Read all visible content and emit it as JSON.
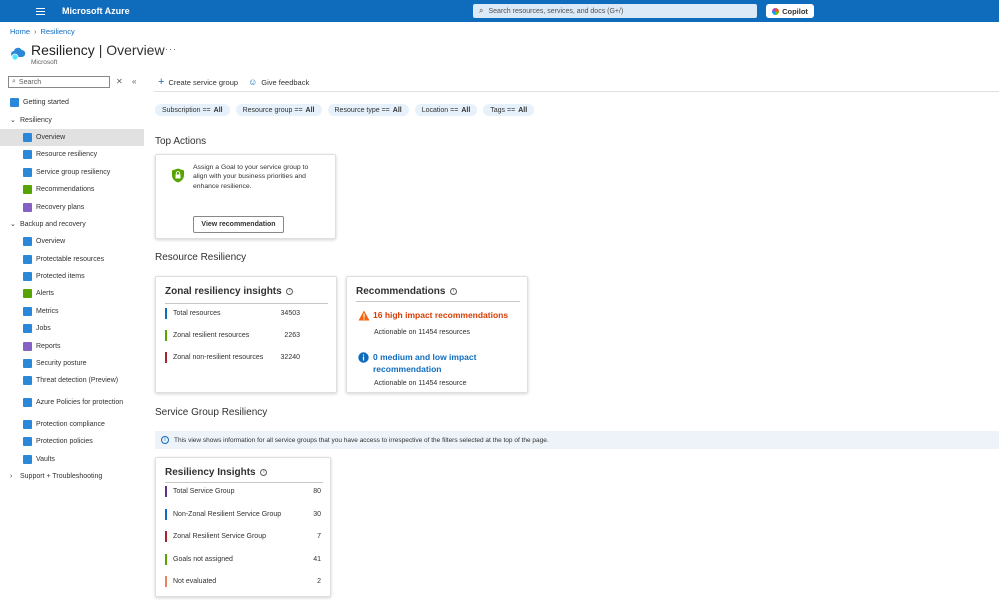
{
  "header": {
    "brand": "Microsoft Azure",
    "search_placeholder": "Search resources, services, and docs (G+/)",
    "copilot_label": "Copilot"
  },
  "breadcrumb": [
    "Home",
    "Resiliency"
  ],
  "page": {
    "title": "Resiliency",
    "title_suffix": "| Overview",
    "subtitle": "Microsoft",
    "more": "···"
  },
  "sidebar": {
    "search_placeholder": "Search",
    "items": [
      {
        "label": "Getting started",
        "level": 0,
        "icon": "rocket-icon",
        "color": "#2b88d8"
      },
      {
        "label": "Resiliency",
        "level": 0,
        "chevron": "⌄",
        "group": true
      },
      {
        "label": "Overview",
        "level": 1,
        "icon": "cloud-icon",
        "color": "#2b88d8",
        "active": true
      },
      {
        "label": "Resource resiliency",
        "level": 1,
        "icon": "resource-icon",
        "color": "#2b88d8"
      },
      {
        "label": "Service group resiliency",
        "level": 1,
        "icon": "service-group-icon",
        "color": "#2b88d8"
      },
      {
        "label": "Recommendations",
        "level": 1,
        "icon": "recommendations-icon",
        "color": "#57a300"
      },
      {
        "label": "Recovery plans",
        "level": 1,
        "icon": "recovery-plans-icon",
        "color": "#8661c5"
      },
      {
        "label": "Backup and recovery",
        "level": 0,
        "chevron": "⌄",
        "group": true
      },
      {
        "label": "Overview",
        "level": 1,
        "icon": "cloud-icon",
        "color": "#2b88d8"
      },
      {
        "label": "Protectable resources",
        "level": 1,
        "icon": "protectable-icon",
        "color": "#2b88d8"
      },
      {
        "label": "Protected items",
        "level": 1,
        "icon": "protected-items-icon",
        "color": "#2b88d8"
      },
      {
        "label": "Alerts",
        "level": 1,
        "icon": "alerts-icon",
        "color": "#57a300"
      },
      {
        "label": "Metrics",
        "level": 1,
        "icon": "metrics-icon",
        "color": "#2b88d8"
      },
      {
        "label": "Jobs",
        "level": 1,
        "icon": "jobs-icon",
        "color": "#2b88d8"
      },
      {
        "label": "Reports",
        "level": 1,
        "icon": "reports-icon",
        "color": "#8661c5"
      },
      {
        "label": "Security posture",
        "level": 1,
        "icon": "security-icon",
        "color": "#2b88d8"
      },
      {
        "label": "Threat detection (Preview)",
        "level": 1,
        "icon": "threat-icon",
        "color": "#2b88d8"
      },
      {
        "label": "Azure Policies for protection",
        "level": 1,
        "icon": "policy-icon",
        "color": "#2b88d8",
        "tall": true
      },
      {
        "label": "Protection compliance",
        "level": 1,
        "icon": "compliance-icon",
        "color": "#2b88d8"
      },
      {
        "label": "Protection policies",
        "level": 1,
        "icon": "protection-policies-icon",
        "color": "#2b88d8"
      },
      {
        "label": "Vaults",
        "level": 1,
        "icon": "vault-icon",
        "color": "#2b88d8"
      },
      {
        "label": "Support + Troubleshooting",
        "level": 0,
        "chevron": "›",
        "group": true
      }
    ]
  },
  "toolbar": {
    "create_label": "Create service group",
    "feedback_label": "Give feedback"
  },
  "filters": [
    {
      "name": "Subscription ==",
      "value": "All"
    },
    {
      "name": "Resource group ==",
      "value": "All"
    },
    {
      "name": "Resource type ==",
      "value": "All"
    },
    {
      "name": "Location ==",
      "value": "All"
    },
    {
      "name": "Tags ==",
      "value": "All"
    }
  ],
  "top_actions": {
    "title": "Top Actions",
    "text": "Assign a Goal to your service group to align with your business priorities and enhance resilience.",
    "button": "View recommendation"
  },
  "resource_resiliency": {
    "title": "Resource Resiliency",
    "zonal": {
      "title": "Zonal resiliency insights",
      "rows": [
        {
          "label": "Total resources",
          "value": "34503",
          "color": "#0f6cbd"
        },
        {
          "label": "Zonal resilient resources",
          "value": "2263",
          "color": "#57a300"
        },
        {
          "label": "Zonal non-resilient resources",
          "value": "32240",
          "color": "#a4262c"
        }
      ]
    },
    "recommendations": {
      "title": "Recommendations",
      "high": {
        "link": "16 high impact recommendations",
        "sub": "Actionable on 11454 resources",
        "color": "#d83b01"
      },
      "low": {
        "link": "0 medium and low impact recommendation",
        "sub": "Actionable on 11454 resource",
        "color": "#0f6cbd"
      }
    }
  },
  "service_group": {
    "title": "Service Group Resiliency",
    "banner": "This view shows information for all service groups that you have access to irrespective of the filters selected at the top of the page.",
    "insights": {
      "title": "Resiliency Insights",
      "rows": [
        {
          "label": "Total Service Group",
          "value": "80",
          "color": "#5c2e91"
        },
        {
          "label": "Non-Zonal Resilient Service Group",
          "value": "30",
          "color": "#0f6cbd"
        },
        {
          "label": "Zonal Resilient Service Group",
          "value": "7",
          "color": "#a4262c"
        },
        {
          "label": "Goals not assigned",
          "value": "41",
          "color": "#57a300"
        },
        {
          "label": "Not evaluated",
          "value": "2",
          "color": "#e9835e"
        }
      ]
    }
  }
}
